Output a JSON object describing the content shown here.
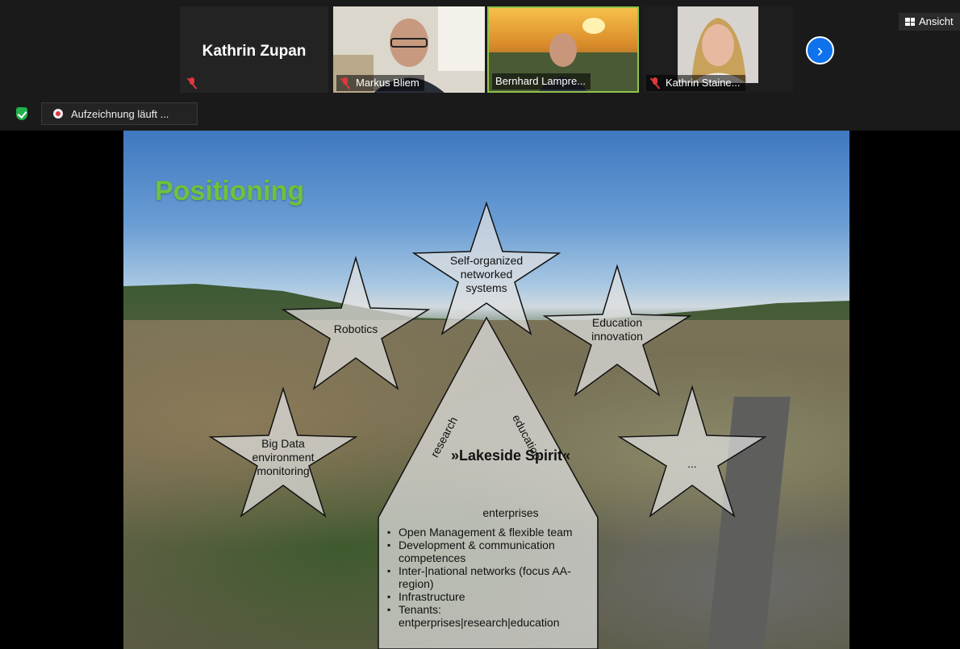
{
  "header": {
    "view_button_label": "Ansicht",
    "recording_label": "Aufzeichnung läuft ..."
  },
  "participants": [
    {
      "name": "Kathrin Zupan",
      "muted": true,
      "video": false
    },
    {
      "name": "Markus Bliem",
      "muted": true,
      "video": true
    },
    {
      "name": "Bernhard Lampre...",
      "muted": false,
      "video": true
    },
    {
      "name": "Kathrin Staine...",
      "muted": true,
      "video": true
    }
  ],
  "slide": {
    "title": "Positioning",
    "stars": {
      "top": "Self-organized networked systems",
      "left": "Robotics",
      "right": "Education innovation",
      "bottom_left": "Big Data environment monitoring",
      "bottom_right": "..."
    },
    "pillar_left": "research",
    "pillar_right": "education",
    "center_title": "»Lakeside Spirit«",
    "base_label": "enterprises",
    "bullets": [
      "Open Management & flexible team",
      "Development & communication competences",
      "Inter-|national networks (focus AA-region)",
      "Infrastructure",
      "Tenants: entperprises|research|education"
    ]
  },
  "colors": {
    "accent_blue": "#0e72ed",
    "mute_red": "#e0373d",
    "secure_green": "#21b04b",
    "slide_title_green": "#6fc23a"
  }
}
